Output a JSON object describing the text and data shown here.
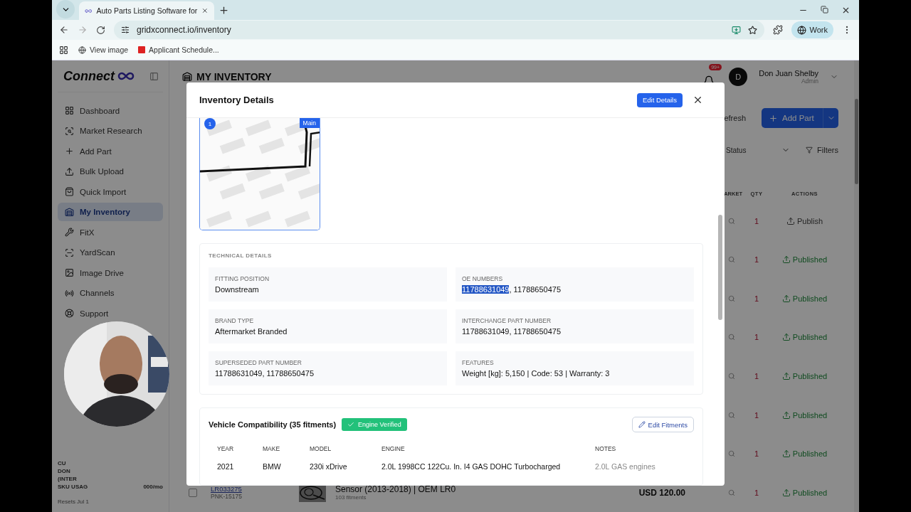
{
  "browser": {
    "tab_title": "Auto Parts Listing Software for",
    "url": "gridxconnect.io/inventory",
    "bookmarks": [
      "View image",
      "Applicant Schedule..."
    ],
    "profile": "Work"
  },
  "sidebar": {
    "logo": "Connect",
    "items": [
      {
        "label": "Dashboard",
        "selected": false
      },
      {
        "label": "Market Research",
        "selected": false
      },
      {
        "label": "Add Part",
        "selected": false
      },
      {
        "label": "Bulk Upload",
        "selected": false
      },
      {
        "label": "Quick Import",
        "selected": false
      },
      {
        "label": "My Inventory",
        "selected": true
      },
      {
        "label": "FitX",
        "selected": false
      },
      {
        "label": "YardScan",
        "selected": false
      },
      {
        "label": "Image Drive",
        "selected": false
      },
      {
        "label": "Channels",
        "selected": false
      },
      {
        "label": "Support",
        "selected": false
      }
    ],
    "footer": {
      "lines": [
        "CU",
        "DON",
        "(INTER"
      ],
      "usage_label": "SKU USAG",
      "usage_value": "000/mo",
      "resets": "Resets Jul 1"
    }
  },
  "header": {
    "title": "MY INVENTORY",
    "notifications": "99+",
    "user": {
      "initial": "D",
      "name": "Don Juan Shelby",
      "role": "Admin"
    }
  },
  "toolbar": {
    "refresh": "efresh",
    "add_part": "Add Part",
    "status": "Status",
    "filters": "Filters"
  },
  "table": {
    "columns": [
      "ARKET",
      "QTY",
      "ACTIONS"
    ],
    "rows": [
      {
        "qty": "1",
        "action": "Publish",
        "published": false
      },
      {
        "qty": "1",
        "action": "Published",
        "published": true
      },
      {
        "qty": "1",
        "action": "Published",
        "published": true
      },
      {
        "qty": "1",
        "action": "Published",
        "published": true
      },
      {
        "qty": "1",
        "action": "Published",
        "published": true
      },
      {
        "qty": "1",
        "action": "Published",
        "published": true
      },
      {
        "qty": "1",
        "action": "Published",
        "published": true
      },
      {
        "qty": "1",
        "action": "Published",
        "published": true,
        "checked": false,
        "sku": "LR033275",
        "part_number": "PNK-15175",
        "title": "Sensor (2013-2018) | OEM LR0",
        "fitments": "103 fitments",
        "price": "USD 120.00"
      }
    ]
  },
  "modal": {
    "title": "Inventory Details",
    "edit_button": "Edit Details",
    "image": {
      "index": "1",
      "badge": "Main",
      "selected": true
    },
    "technical": {
      "title": "TECHNICAL DETAILS",
      "fields": [
        {
          "label": "FITTING POSITION",
          "value": "Downstream"
        },
        {
          "label": "OE NUMBERS",
          "selected_text": "11788631049",
          "value": ", 11788650475"
        },
        {
          "label": "BRAND TYPE",
          "value": "Aftermarket Branded"
        },
        {
          "label": "INTERCHANGE PART NUMBER",
          "value": "11788631049, 11788650475"
        },
        {
          "label": "SUPERSEDED PART NUMBER",
          "value": "11788631049, 11788650475"
        },
        {
          "label": "FEATURES",
          "value": "Weight [kg]: 5,150 | Code: 53 | Warranty: 3"
        }
      ]
    },
    "compatibility": {
      "title": "Vehicle Compatibility (35 fitments)",
      "badge": "Engine Verified",
      "edit_button": "Edit Fitments",
      "columns": [
        "YEAR",
        "MAKE",
        "MODEL",
        "ENGINE",
        "NOTES"
      ],
      "rows": [
        [
          "2021",
          "BMW",
          "230i xDrive",
          "2.0L 1998CC 122Cu. In. I4 GAS DOHC Turbocharged",
          "2.0L GAS engines"
        ]
      ]
    }
  }
}
